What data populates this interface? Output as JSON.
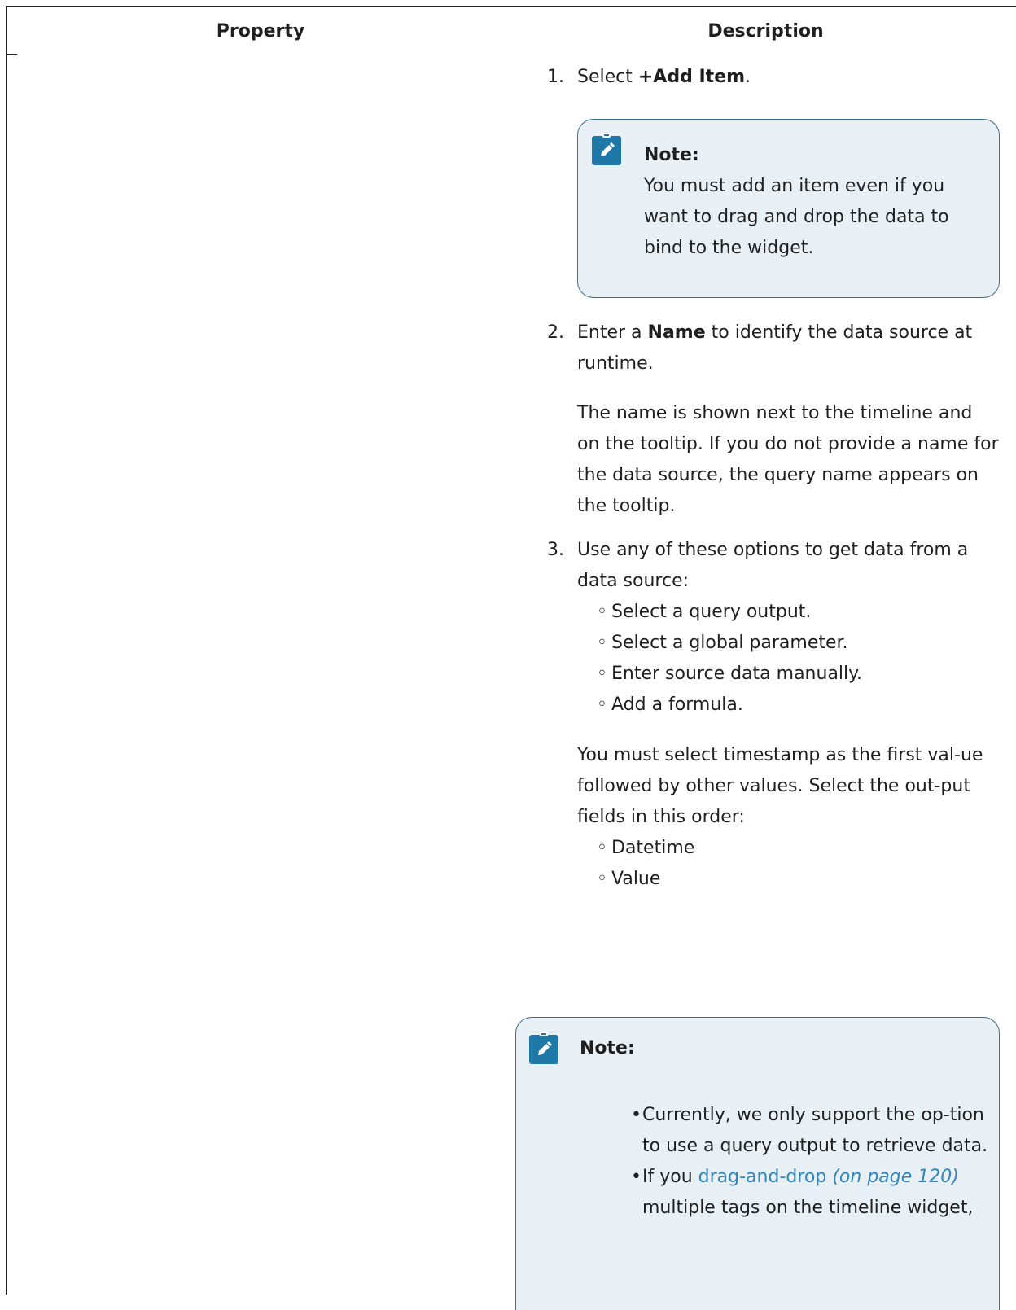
{
  "table": {
    "header": {
      "property": "Property",
      "description": "Description"
    }
  },
  "steps": {
    "step1": {
      "num": "1.",
      "pre": "Select ",
      "bold": "+Add Item",
      "post": "."
    },
    "note1": {
      "title": "Note:",
      "body": "You must add an item even if you want to drag and drop the data to bind to the widget.",
      "icon": "pencil-note-icon"
    },
    "step2": {
      "num": "2.",
      "pre": "Enter a ",
      "bold": "Name",
      "post": " to identify the data source at runtime.",
      "detail": "The name is shown next to the timeline and on the tooltip. If you do not provide a name for the data source, the query name appears on the tooltip."
    },
    "step3": {
      "num": "3.",
      "text": "Use any of these options to get data from a data source:",
      "options": [
        "Select a query output.",
        "Select a global parameter.",
        "Enter source data manually.",
        "Add a formula."
      ],
      "detail": "You must select timestamp as the first val-ue followed by other values. Select the out-put fields in this order:",
      "fields": [
        "Datetime",
        "Value"
      ]
    },
    "note2": {
      "title": "Note:",
      "icon": "pencil-note-icon",
      "bullet1": "Currently, we only support the op-tion to use a query output to retrieve data.",
      "bullet2_pre": "If you ",
      "bullet2_link": "drag-and-drop",
      "bullet2_ref": "(on page 120)",
      "bullet2_post": "multiple tags on the timeline widget,"
    }
  },
  "colors": {
    "note_bg": "#e8f0f6",
    "note_border": "#3c6f8c",
    "icon": "#1f79a8",
    "link": "#2f86b8"
  }
}
